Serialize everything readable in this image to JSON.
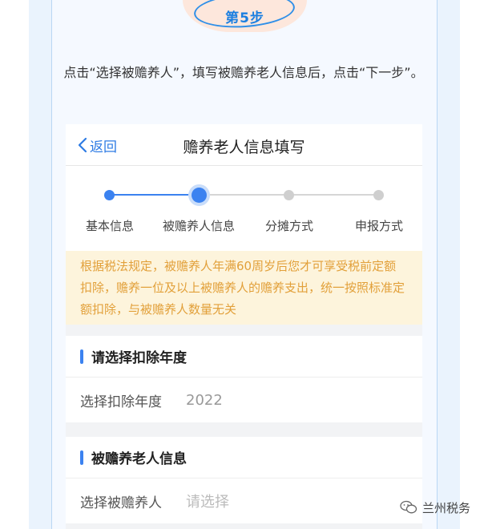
{
  "step_badge": "第5步",
  "instruction": "点击“选择被赡养人”，填写被赡养老人信息后，点击“下一步”。",
  "topbar": {
    "back_label": "返回",
    "title": "赡养老人信息填写"
  },
  "stepper": {
    "steps": [
      "基本信息",
      "被赡养人信息",
      "分摊方式",
      "申报方式"
    ],
    "current_step": 2
  },
  "notice": "根据税法规定，被赡养人年满60周岁后您才可享受税前定额扣除，赡养一位及以上被赡养人的赡养支出，统一按照标准定额扣除，与被赡养人数量无关",
  "deduction_year": {
    "title": "请选择扣除年度",
    "label": "选择扣除年度",
    "value": "2022"
  },
  "elder_info": {
    "title": "被赡养老人信息",
    "label": "选择被赡养人",
    "placeholder": "请选择"
  },
  "watermark": "兰州税务",
  "colors": {
    "accent": "#3b82f0",
    "notice_text": "#e2a03a",
    "notice_bg": "#fdf4dc"
  }
}
